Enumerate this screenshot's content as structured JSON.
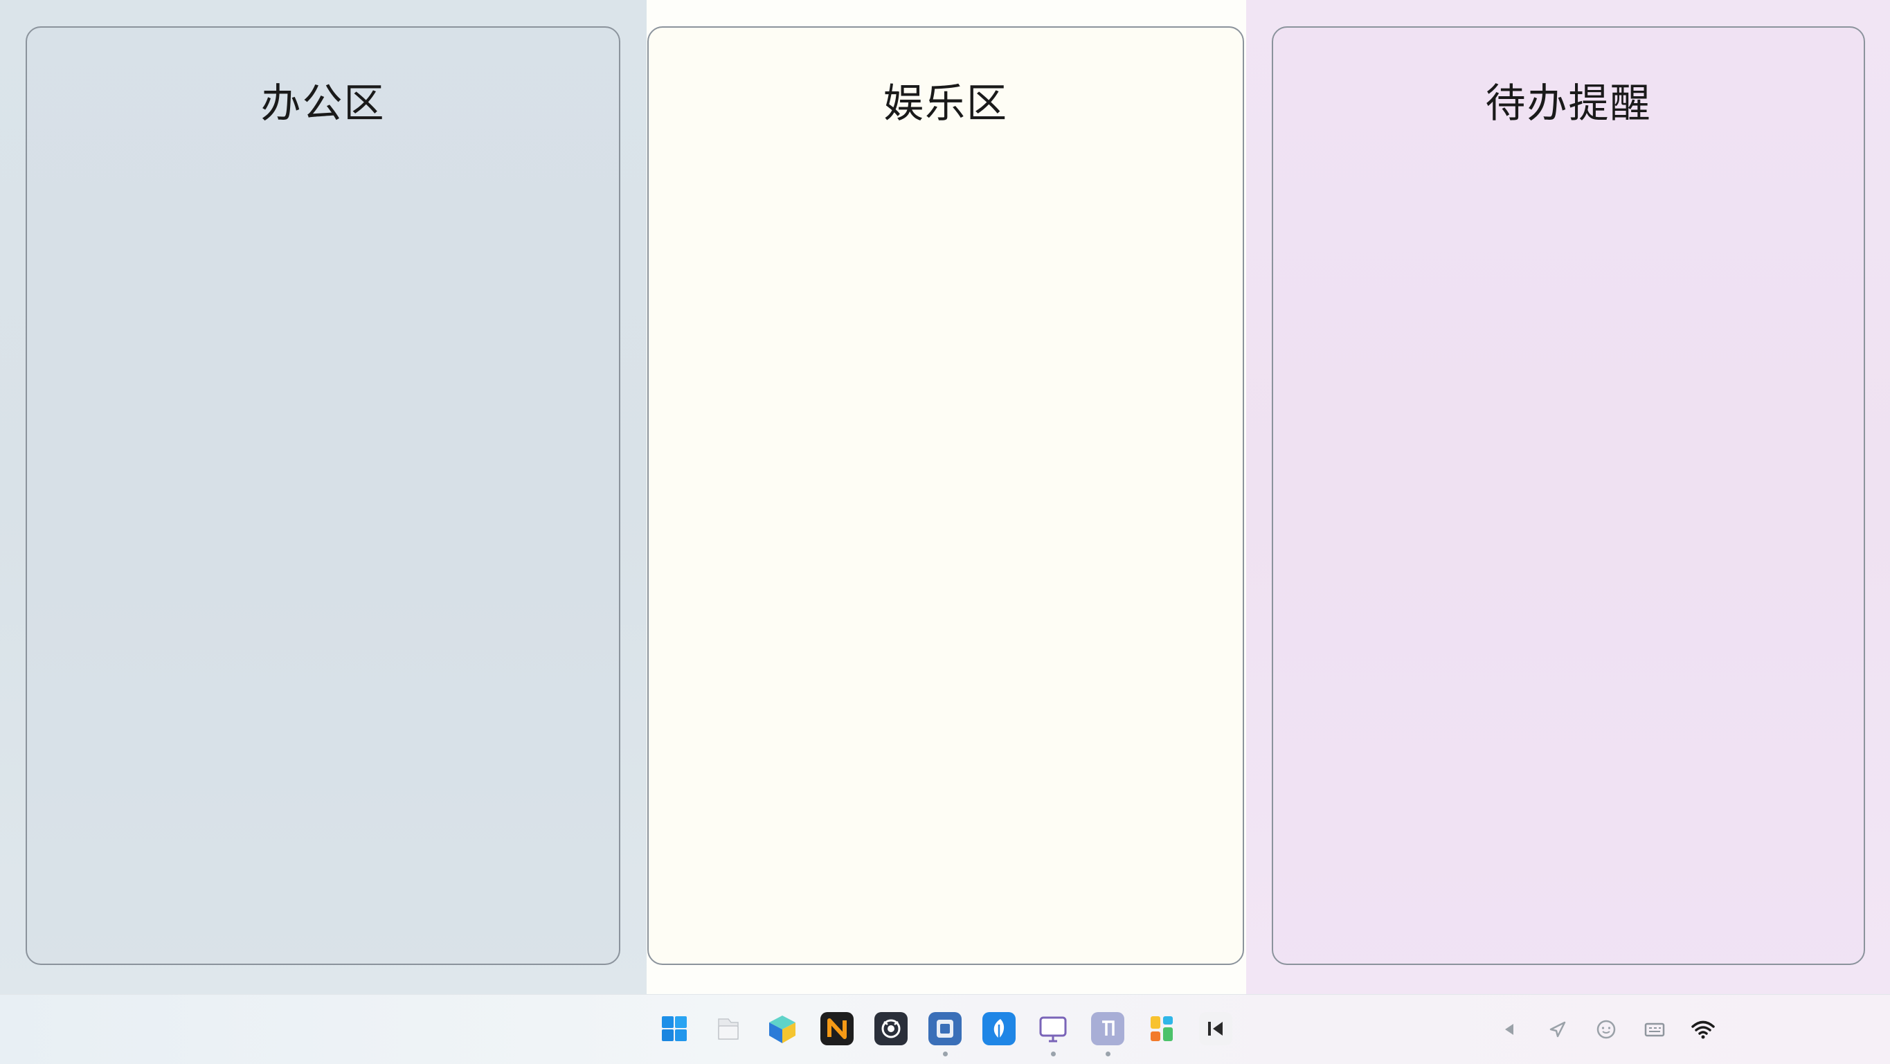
{
  "zones": {
    "office": {
      "title": "办公区",
      "color": "#dbe4ea"
    },
    "entertainment": {
      "title": "娱乐区",
      "color": "#fefefa"
    },
    "todo": {
      "title": "待办提醒",
      "color": "#f1e5f4"
    }
  },
  "taskbar": {
    "apps": [
      {
        "icon": "windows-start-icon",
        "running": false
      },
      {
        "icon": "file-explorer-icon",
        "running": false
      },
      {
        "icon": "3d-cube-app-icon",
        "running": false
      },
      {
        "icon": "orange-n-app-icon",
        "running": false
      },
      {
        "icon": "dark-camera-app-icon",
        "running": false
      },
      {
        "icon": "blue-box-app-icon",
        "running": true
      },
      {
        "icon": "blue-feather-app-icon",
        "running": false
      },
      {
        "icon": "monitor-app-icon",
        "running": true
      },
      {
        "icon": "grey-square-app-icon",
        "running": true
      },
      {
        "icon": "colorful-grid-app-icon",
        "running": false
      },
      {
        "icon": "media-player-icon",
        "running": false
      }
    ],
    "tray": [
      "chevron-left-icon",
      "send-icon",
      "smiley-face-icon",
      "keyboard-ime-icon",
      "wifi-icon"
    ],
    "clock": {
      "time": "",
      "date": ""
    }
  }
}
